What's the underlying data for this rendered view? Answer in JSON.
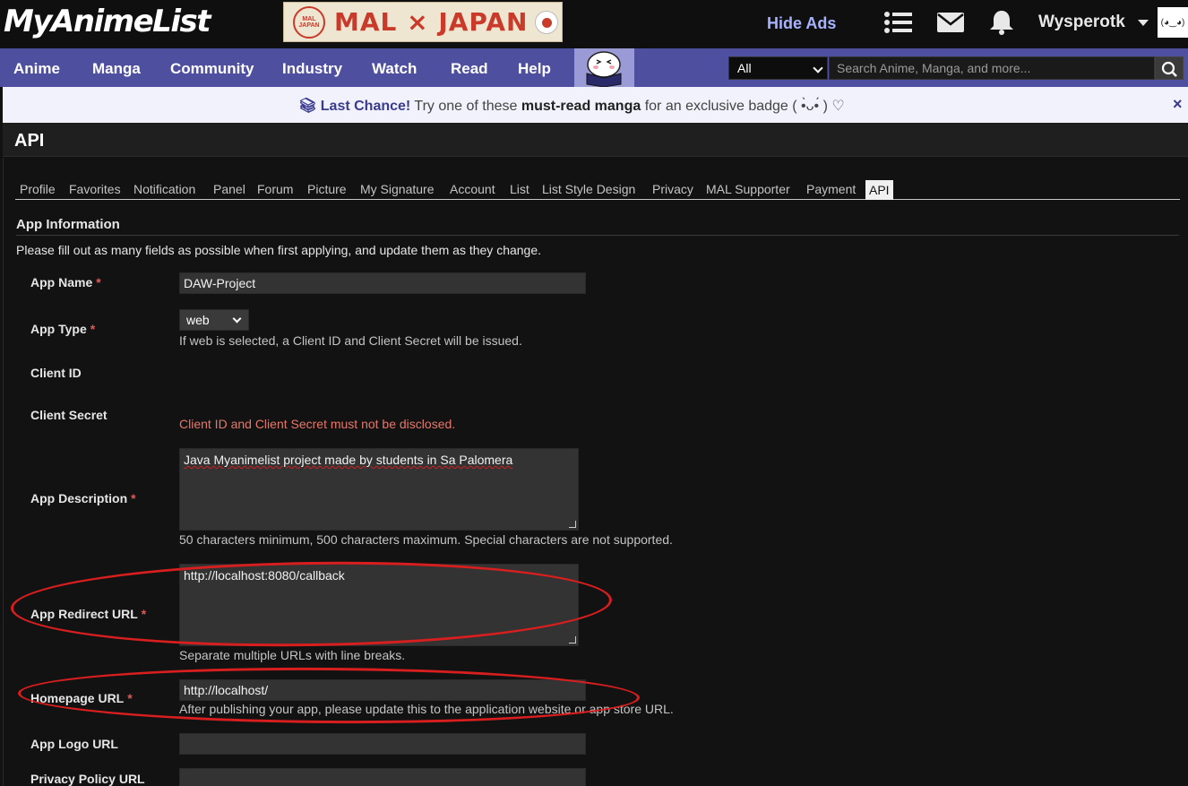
{
  "header": {
    "logo": "MyAnimeList",
    "banner_text": "MAL × JAPAN",
    "banner_seal": "MAL JAPAN",
    "hide_ads": "Hide Ads",
    "username": "Wysperotk",
    "avatar_text": "(◕‿◕)"
  },
  "nav": {
    "items": [
      "Anime",
      "Manga",
      "Community",
      "Industry",
      "Watch",
      "Read",
      "Help"
    ],
    "search_scope": "All",
    "search_placeholder": "Search Anime, Manga, and more..."
  },
  "promo": {
    "lead": "Last Chance!",
    "text_1": "Try one of these",
    "highlight": "must-read manga",
    "text_2": "for an exclusive badge ( •̀ᴗ•́ ) ♡",
    "close": "×"
  },
  "page": {
    "title": "API",
    "tabs": [
      "Profile",
      "Favorites",
      "Notification",
      "Panel",
      "Forum",
      "Picture",
      "My Signature",
      "Account",
      "List",
      "List Style Design",
      "Privacy",
      "MAL Supporter",
      "Payment",
      "API"
    ],
    "active_tab": "API"
  },
  "form": {
    "section_title": "App Information",
    "intro": "Please fill out as many fields as possible when first applying, and update them as they change.",
    "required_mark": "*",
    "app_name": {
      "label": "App Name",
      "value": "DAW-Project"
    },
    "app_type": {
      "label": "App Type",
      "value": "web",
      "hint": "If web is selected, a Client ID and Client Secret will be issued."
    },
    "client_id": {
      "label": "Client ID"
    },
    "client_secret": {
      "label": "Client Secret",
      "warning": "Client ID and Client Secret must not be disclosed."
    },
    "app_description": {
      "label": "App Description",
      "value": "Java Myanimelist project made by students in Sa Palomera",
      "hint": "50 characters minimum, 500 characters maximum. Special characters are not supported."
    },
    "redirect_url": {
      "label": "App Redirect URL",
      "value": "http://localhost:8080/callback",
      "hint": "Separate multiple URLs with line breaks."
    },
    "homepage_url": {
      "label": "Homepage URL",
      "value": "http://localhost/",
      "hint": "After publishing your app, please update this to the application website or app store URL."
    },
    "logo_url": {
      "label": "App Logo URL",
      "value": ""
    },
    "privacy_url": {
      "label": "Privacy Policy URL",
      "value": ""
    }
  },
  "colors": {
    "nav_bg": "#4f4fa0",
    "annotation": "#d81e1e",
    "required": "#e05a5a",
    "link_accent": "#a7b3ff"
  }
}
